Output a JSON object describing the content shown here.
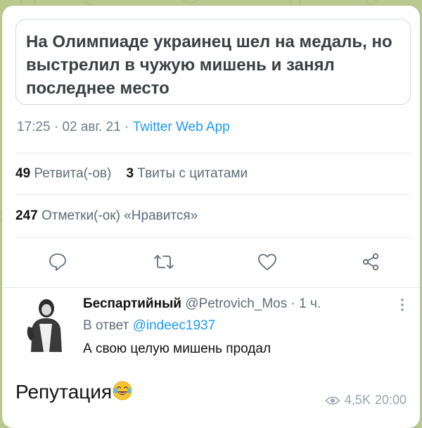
{
  "quoted_headline": "На Олимпиаде украинец шел на медаль, но выстрелил в чужую мишень и занял последнее место",
  "tweet_meta": {
    "time": "17:25",
    "date": "02 авг. 21",
    "source": "Twitter Web App"
  },
  "stats": {
    "retweets_count": "49",
    "retweets_label": "Ретвита(-ов)",
    "quotes_count": "3",
    "quotes_label": "Твиты с цитатами",
    "likes_count": "247",
    "likes_label": "Отметки(-ок) «Нравится»"
  },
  "actions": [
    "reply-icon",
    "retweet-icon",
    "like-icon",
    "share-icon"
  ],
  "reply": {
    "name": "Беспартийный",
    "handle": "@Petrovich_Mos",
    "time": "1 ч.",
    "reply_to_label": "В ответ",
    "reply_to_handle": "@indeec1937",
    "text": "А свою целую мишень продал"
  },
  "post": {
    "caption": "Репутация",
    "emoji": "😂",
    "views": "4,5K",
    "time": "20:00"
  },
  "colors": {
    "link": "#1d9bf0",
    "muted": "#6f7f8c",
    "chat_background": "#b9c98f"
  }
}
